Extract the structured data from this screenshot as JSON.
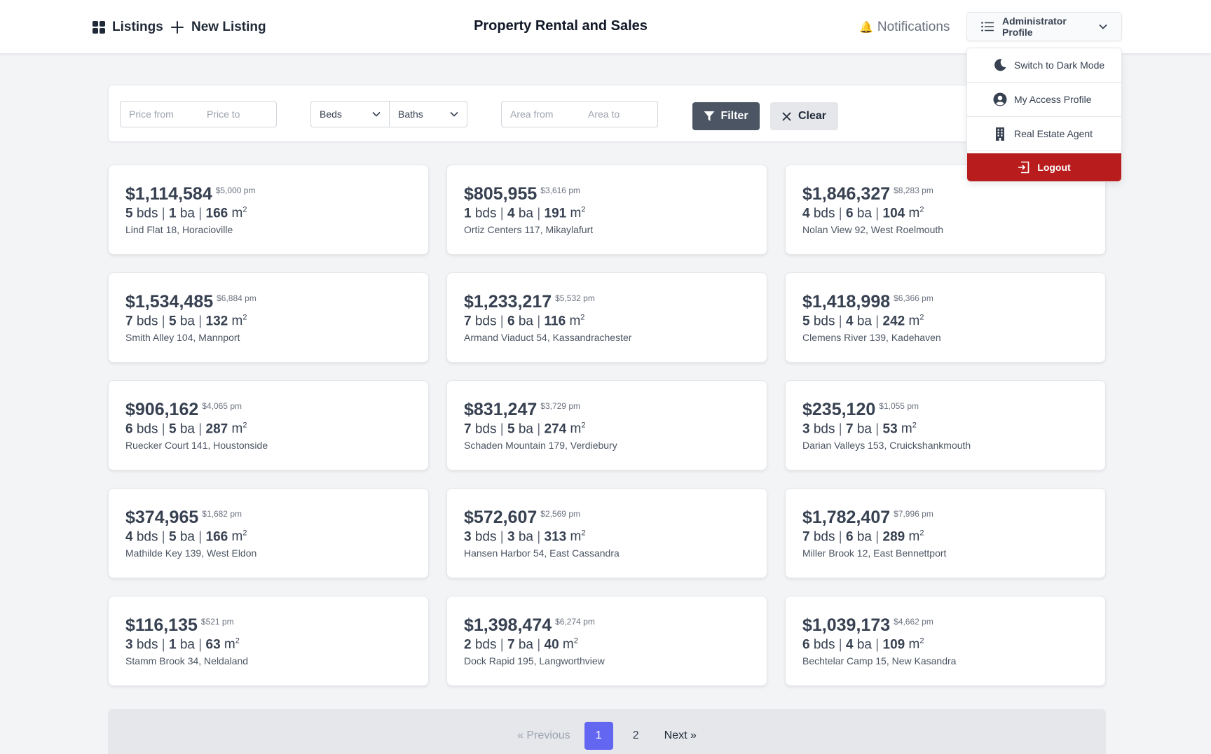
{
  "header": {
    "listings_label": "Listings",
    "new_listing_label": "New Listing",
    "title": "Property Rental and Sales",
    "notifications_label": "Notifications",
    "notifications_icon": "🔔",
    "profile_label": "Administrator Profile"
  },
  "profile_menu": {
    "dark_mode_label": "Switch to Dark Mode",
    "access_profile_label": "My Access Profile",
    "agent_label": "Real Estate Agent",
    "logout_label": "Logout"
  },
  "filters": {
    "price_from_placeholder": "Price from",
    "price_to_placeholder": "Price to",
    "beds_label": "Beds",
    "baths_label": "Baths",
    "area_from_placeholder": "Area from",
    "area_to_placeholder": "Area to",
    "filter_label": "Filter",
    "clear_label": "Clear"
  },
  "listings": [
    {
      "price": "$1,114,584",
      "rent": "$5,000 pm",
      "beds": "5",
      "baths": "1",
      "area": "166",
      "address": "Lind Flat 18, Horacioville"
    },
    {
      "price": "$805,955",
      "rent": "$3,616 pm",
      "beds": "1",
      "baths": "4",
      "area": "191",
      "address": "Ortiz Centers 117, Mikaylafurt"
    },
    {
      "price": "$1,846,327",
      "rent": "$8,283 pm",
      "beds": "4",
      "baths": "6",
      "area": "104",
      "address": "Nolan View 92, West Roelmouth"
    },
    {
      "price": "$1,534,485",
      "rent": "$6,884 pm",
      "beds": "7",
      "baths": "5",
      "area": "132",
      "address": "Smith Alley 104, Mannport"
    },
    {
      "price": "$1,233,217",
      "rent": "$5,532 pm",
      "beds": "7",
      "baths": "6",
      "area": "116",
      "address": "Armand Viaduct 54, Kassandrachester"
    },
    {
      "price": "$1,418,998",
      "rent": "$6,366 pm",
      "beds": "5",
      "baths": "4",
      "area": "242",
      "address": "Clemens River 139, Kadehaven"
    },
    {
      "price": "$906,162",
      "rent": "$4,065 pm",
      "beds": "6",
      "baths": "5",
      "area": "287",
      "address": "Ruecker Court 141, Houstonside"
    },
    {
      "price": "$831,247",
      "rent": "$3,729 pm",
      "beds": "7",
      "baths": "5",
      "area": "274",
      "address": "Schaden Mountain 179, Verdiebury"
    },
    {
      "price": "$235,120",
      "rent": "$1,055 pm",
      "beds": "3",
      "baths": "7",
      "area": "53",
      "address": "Darian Valleys 153, Cruickshankmouth"
    },
    {
      "price": "$374,965",
      "rent": "$1,682 pm",
      "beds": "4",
      "baths": "5",
      "area": "166",
      "address": "Mathilde Key 139, West Eldon"
    },
    {
      "price": "$572,607",
      "rent": "$2,569 pm",
      "beds": "3",
      "baths": "3",
      "area": "313",
      "address": "Hansen Harbor 54, East Cassandra"
    },
    {
      "price": "$1,782,407",
      "rent": "$7,996 pm",
      "beds": "7",
      "baths": "6",
      "area": "289",
      "address": "Miller Brook 12, East Bennettport"
    },
    {
      "price": "$116,135",
      "rent": "$521 pm",
      "beds": "3",
      "baths": "1",
      "area": "63",
      "address": "Stamm Brook 34, Neldaland"
    },
    {
      "price": "$1,398,474",
      "rent": "$6,274 pm",
      "beds": "2",
      "baths": "7",
      "area": "40",
      "address": "Dock Rapid 195, Langworthview"
    },
    {
      "price": "$1,039,173",
      "rent": "$4,662 pm",
      "beds": "6",
      "baths": "4",
      "area": "109",
      "address": "Bechtelar Camp 15, New Kasandra"
    }
  ],
  "units": {
    "beds": "bds",
    "baths": "ba",
    "area": "m",
    "area_sup": "2",
    "separator": "|"
  },
  "pagination": {
    "previous_label": "« Previous",
    "pages": [
      "1",
      "2"
    ],
    "current": "1",
    "next_label": "Next »"
  },
  "colors": {
    "accent": "#6366f1",
    "logout": "#b91c1c",
    "filter_button": "#4b5563"
  }
}
